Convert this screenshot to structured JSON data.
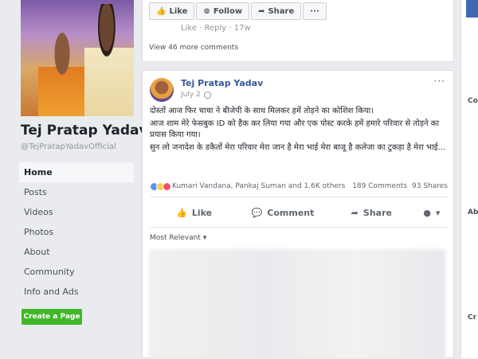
{
  "page": {
    "name": "Tej Pratap Yadav",
    "handle": "@TejPratapYadavOfficial"
  },
  "nav": {
    "items": [
      "Home",
      "Posts",
      "Videos",
      "Photos",
      "About",
      "Community",
      "Info and Ads"
    ],
    "create_page": "Create a Page"
  },
  "prev_post": {
    "like": "Like",
    "follow": "Follow",
    "share": "Share",
    "more": "···",
    "reply_line": "Like · Reply · 17w",
    "view_more": "View 46 more comments"
  },
  "post": {
    "author": "Tej Pratap Yadav",
    "date": "July 2",
    "more": "···",
    "text": [
      "दोस्तों आज फिर चाचा ने बीजेपी के साथ मिलकर हमें तोड़ने का कोशिश किया।",
      "आज शाम मेरे फेसबुक ID को हैक कर लिया गया और एक पोस्ट करके हमें हमारे परिवार से तोड़ने का प्रयास किया गया।",
      "सुन लो जनादेश के डकैतों मेरा परिवार मेरा जान है मेरा भाई मेरा बाजू है कलेजा का टुकड़ा है मेरा भाई..."
    ],
    "reactions": "Kumari Vandana, Pankaj Suman and 1.6K others",
    "comments": "189 Comments",
    "shares": "93 Shares",
    "like": "Like",
    "comment": "Comment",
    "share": "Share",
    "most_relevant": "Most Relevant ▾"
  },
  "right": {
    "a": "Co",
    "b": "Ab",
    "c": "Cr"
  }
}
